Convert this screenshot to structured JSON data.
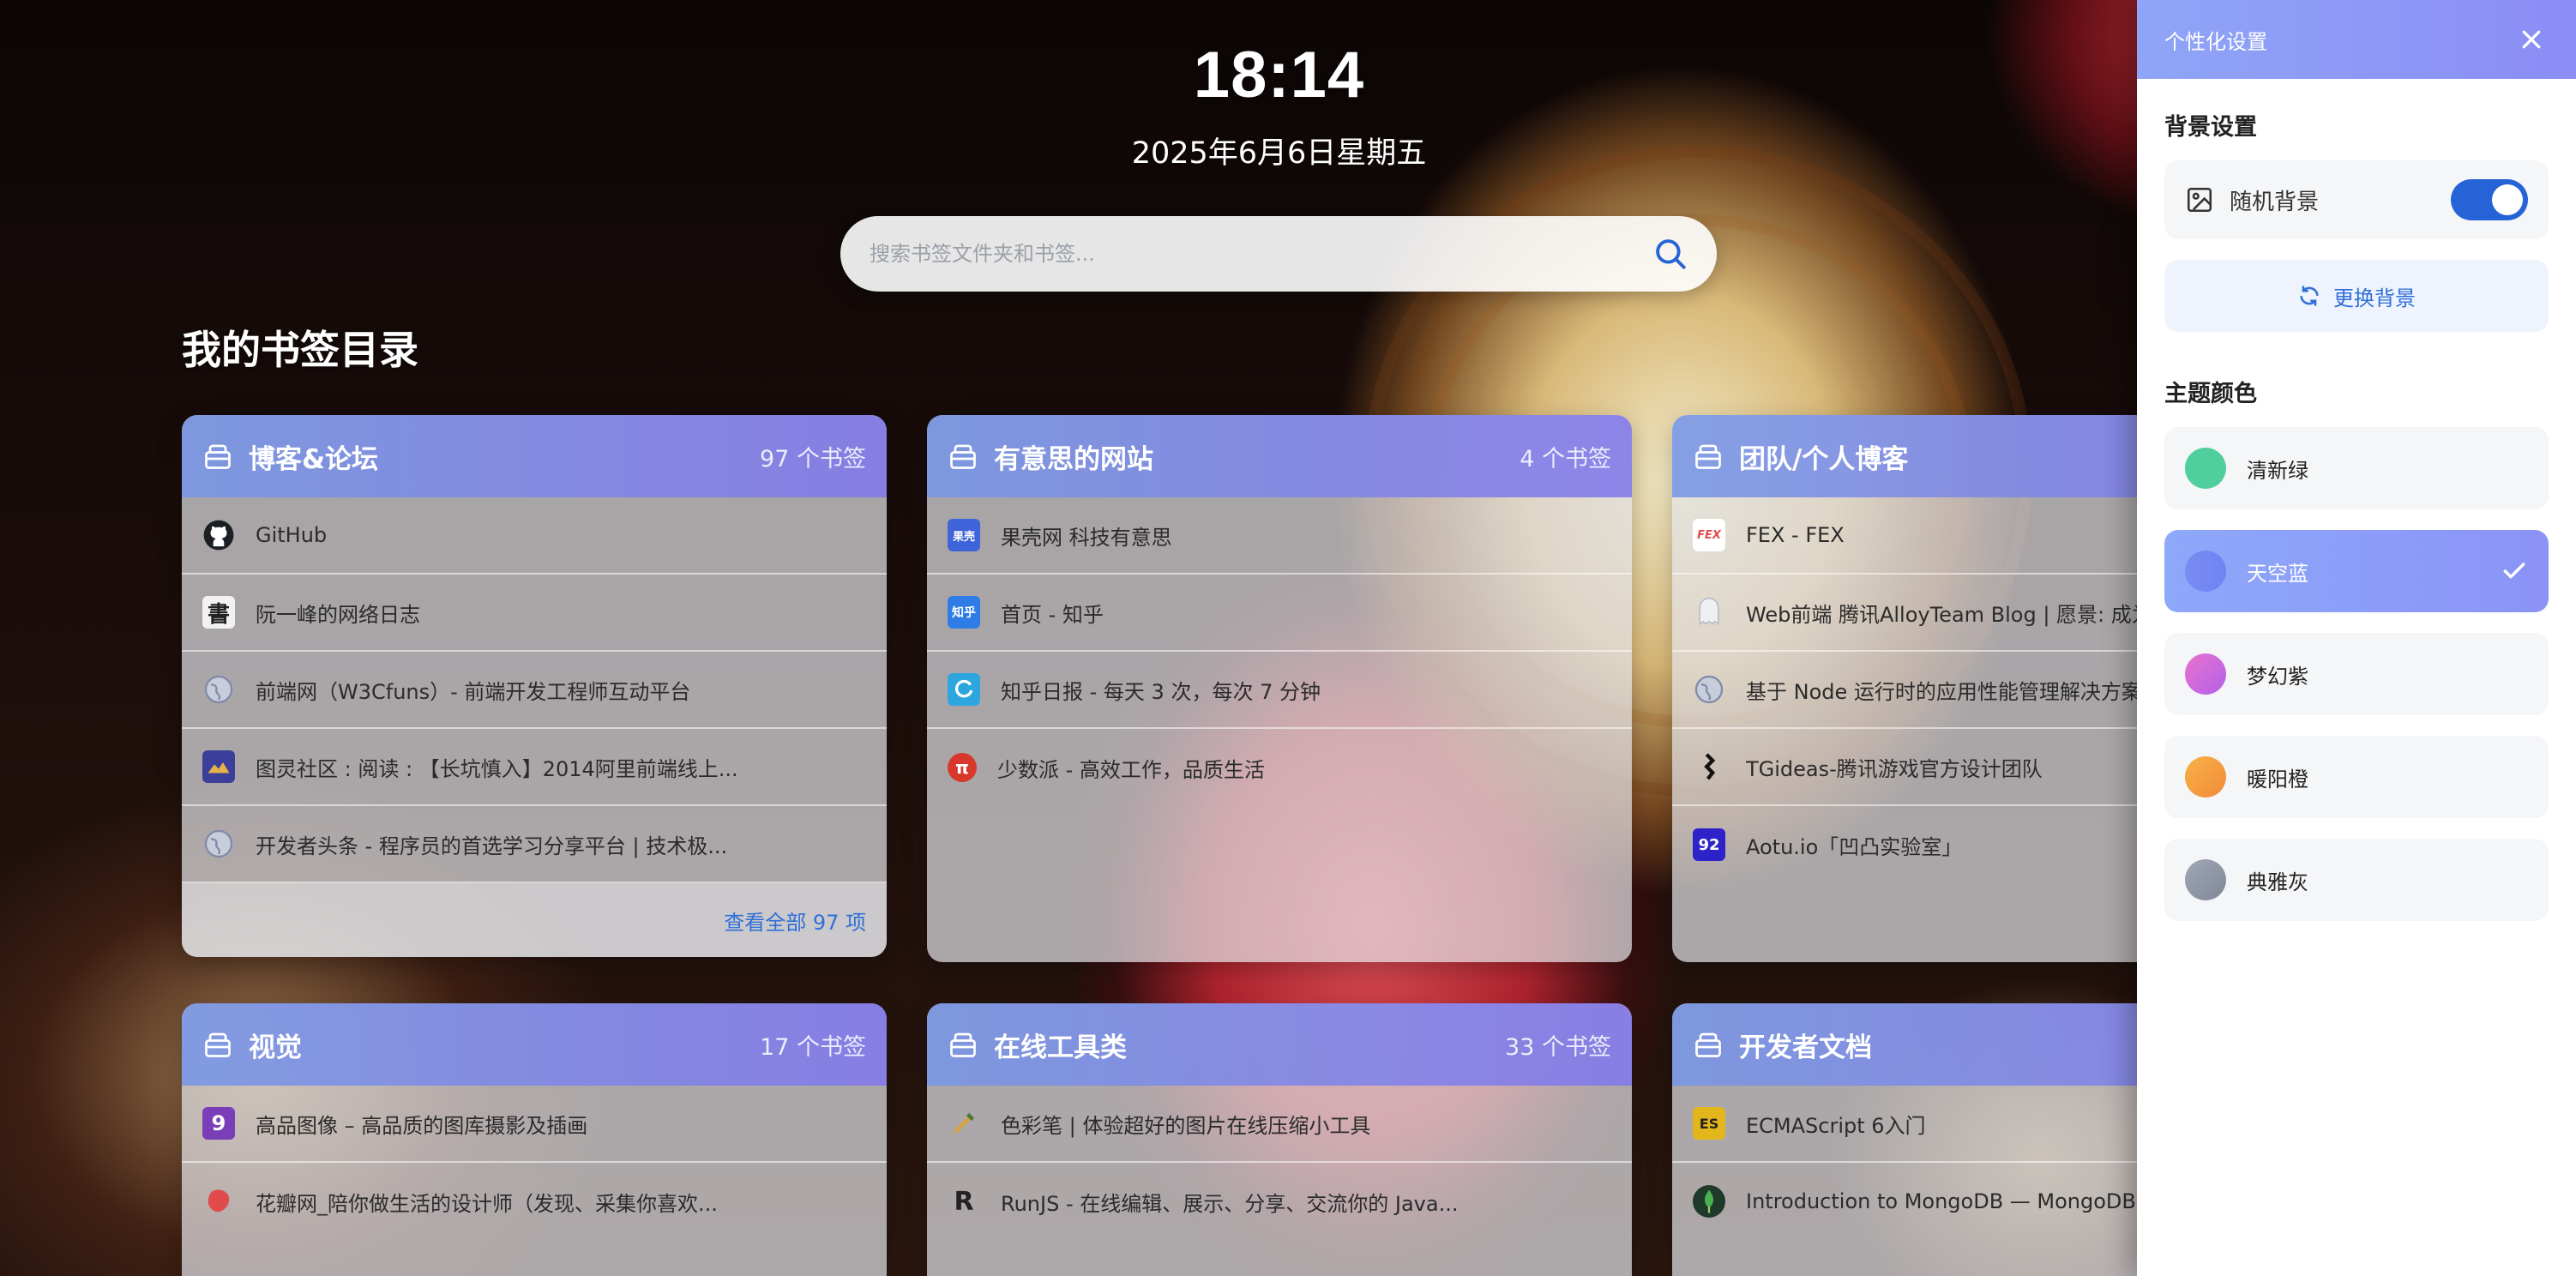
{
  "clock": {
    "time": "18:14",
    "date": "2025年6月6日星期五"
  },
  "search": {
    "placeholder": "搜索书签文件夹和书签..."
  },
  "section_title": "我的书签目录",
  "cards": [
    {
      "title": "博客&论坛",
      "count": "97 个书签",
      "items": [
        {
          "label": "GitHub",
          "icon": "github-icon",
          "color": "#1b1f23"
        },
        {
          "label": "阮一峰的网络日志",
          "icon": "ruanyifeng-icon",
          "color": "#333333"
        },
        {
          "label": "前端网（W3Cfuns）- 前端开发工程师互动平台",
          "icon": "globe-icon",
          "color": "#7f8aa8"
        },
        {
          "label": "图灵社区 : 阅读 : 【长坑慎入】2014阿里前端线上...",
          "icon": "ituring-icon",
          "color": "#5b4aa0"
        },
        {
          "label": "开发者头条 - 程序员的首选学习分享平台 | 技术极...",
          "icon": "globe-icon",
          "color": "#7f8aa8"
        }
      ],
      "footer": "查看全部 97 项"
    },
    {
      "title": "有意思的网站",
      "count": "4 个书签",
      "items": [
        {
          "label": "果壳网 科技有意思",
          "icon": "guokr-icon",
          "color": "#3f63d8",
          "text": "果壳"
        },
        {
          "label": "首页 - 知乎",
          "icon": "zhihu-icon",
          "color": "#2e7ce6",
          "text": "知乎"
        },
        {
          "label": "知乎日报 - 每天 3 次，每次 7 分钟",
          "icon": "zhihu-daily-icon",
          "color": "#2da6e0"
        },
        {
          "label": "少数派 - 高效工作，品质生活",
          "icon": "sspai-icon",
          "color": "#d7382b",
          "text": "π"
        }
      ]
    },
    {
      "title": "团队/个人博客",
      "count": "",
      "items": [
        {
          "label": "FEX - FEX",
          "icon": "fex-icon",
          "color": "#ffffff",
          "text": "FEX"
        },
        {
          "label": "Web前端 腾讯AlloyTeam Blog | 愿景: 成为",
          "icon": "alloyteam-icon",
          "color": "#dfe3ea"
        },
        {
          "label": "基于 Node 运行时的应用性能管理解决方案",
          "icon": "globe-icon",
          "color": "#7f8aa8"
        },
        {
          "label": "TGideas-腾讯游戏官方设计团队",
          "icon": "tgideas-icon",
          "color": "#111111"
        },
        {
          "label": "Aotu.io「凹凸实验室」",
          "icon": "aotu-icon",
          "color": "#2e22c9",
          "text": "92"
        }
      ]
    },
    {
      "title": "视觉",
      "count": "17 个书签",
      "items": [
        {
          "label": "高品图像 – 高品质的图库摄影及插画",
          "icon": "gaopin-icon",
          "color": "#7a3fb8",
          "text": "9"
        },
        {
          "label": "花瓣网_陪你做生活的设计师（发现、采集你喜欢...",
          "icon": "huaban-icon",
          "color": "#e24b4b"
        }
      ]
    },
    {
      "title": "在线工具类",
      "count": "33 个书签",
      "items": [
        {
          "label": "色彩笔 | 体验超好的图片在线压缩小工具",
          "icon": "pen-icon",
          "color": "#d9a13b"
        },
        {
          "label": "RunJS - 在线编辑、展示、分享、交流你的 Java...",
          "icon": "runjs-icon",
          "color": "#222222",
          "text": "R"
        }
      ]
    },
    {
      "title": "开发者文档",
      "count": "",
      "items": [
        {
          "label": "ECMAScript 6入门",
          "icon": "es6-icon",
          "color": "#e3b71c",
          "text": "ES"
        },
        {
          "label": "Introduction to MongoDB — MongoDB M",
          "icon": "mongodb-icon",
          "color": "#1f7a3a"
        }
      ]
    }
  ],
  "panel": {
    "title": "个性化设置",
    "bg_section": "背景设置",
    "random_bg": "随机背景",
    "random_bg_enabled": true,
    "change_bg": "更换背景",
    "theme_section": "主题颜色",
    "themes": [
      {
        "label": "清新绿",
        "color": "#4fcf9e",
        "selected": false
      },
      {
        "label": "天空蓝",
        "color": "#7b8cf2",
        "selected": true
      },
      {
        "label": "梦幻紫",
        "color": "#d06ce0",
        "selected": false
      },
      {
        "label": "暖阳橙",
        "color": "#f59b3c",
        "selected": false
      },
      {
        "label": "典雅灰",
        "color": "#8e96a6",
        "selected": false
      }
    ]
  }
}
